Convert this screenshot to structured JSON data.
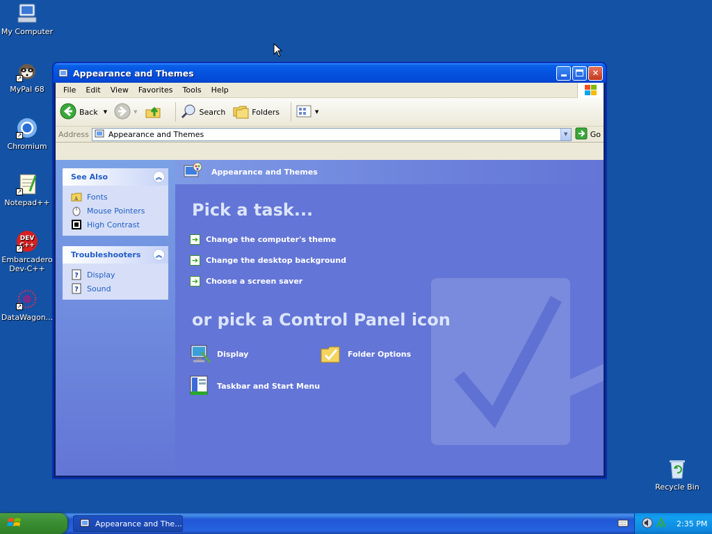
{
  "desktop": {
    "icons": [
      {
        "label": "My Computer"
      },
      {
        "label": "MyPal 68"
      },
      {
        "label": "Chromium"
      },
      {
        "label": "Notepad++"
      },
      {
        "label": "Embarcadero Dev-C++"
      },
      {
        "label": "DataWagon..."
      },
      {
        "label": "Recycle Bin"
      }
    ]
  },
  "window": {
    "title": "Appearance and Themes",
    "menu": [
      "File",
      "Edit",
      "View",
      "Favorites",
      "Tools",
      "Help"
    ],
    "toolbar": {
      "back_label": "Back",
      "search_label": "Search",
      "folders_label": "Folders"
    },
    "address": {
      "label": "Address",
      "value": "Appearance and Themes",
      "go_label": "Go"
    },
    "see_also": {
      "title": "See Also",
      "items": [
        "Fonts",
        "Mouse Pointers",
        "High Contrast"
      ]
    },
    "troubleshooters": {
      "title": "Troubleshooters",
      "items": [
        "Display",
        "Sound"
      ]
    },
    "header_title": "Appearance and Themes",
    "pick_task_title": "Pick a task...",
    "tasks": [
      "Change the computer's theme",
      "Change the desktop background",
      "Choose a screen saver"
    ],
    "or_pick_title": "or pick a Control Panel icon",
    "cp_icons": [
      "Display",
      "Folder Options",
      "Taskbar and Start Menu"
    ]
  },
  "taskbar": {
    "task_item": "Appearance and The...",
    "clock": "2:35 PM"
  }
}
